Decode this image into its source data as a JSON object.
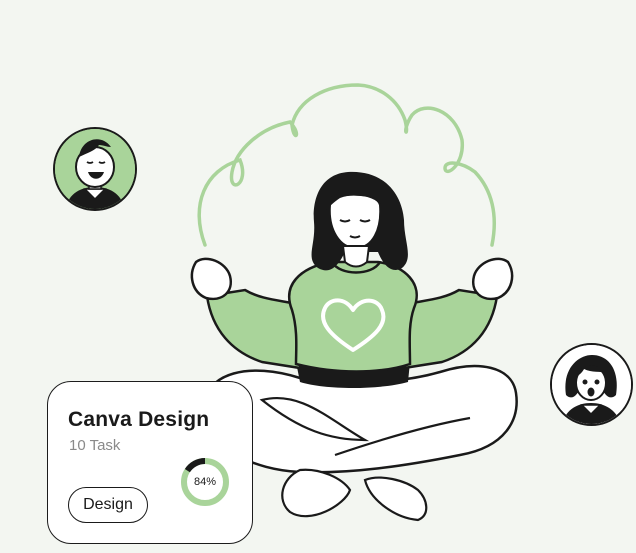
{
  "task_card": {
    "title": "Canva Design",
    "subtitle": "10 Task",
    "progress_label": "84%",
    "progress": 0.84,
    "tag_label": "Design"
  },
  "colors": {
    "background": "#f3f6f1",
    "accent_green": "#a9d49a",
    "ring_dark": "#1a1a1a",
    "outline": "#1a1a1a"
  },
  "icons": {
    "illustration": "meditating-woman-illustration",
    "avatar_left": "man-avatar-icon",
    "avatar_right": "woman-avatar-icon"
  }
}
